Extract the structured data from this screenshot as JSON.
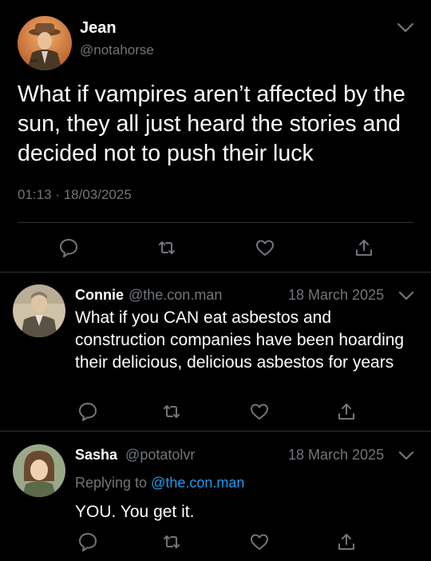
{
  "main_tweet": {
    "name": "Jean",
    "handle": "@notahorse",
    "text": "What if vampires aren’t affected by the sun, they all just heard the stories and decided not to push their luck",
    "time": "01:13",
    "separator": "·",
    "date": "18/03/2025"
  },
  "replies": [
    {
      "name": "Connie",
      "handle": "@the.con.man",
      "date": "18 March 2025",
      "text": "What if you CAN eat asbestos and construction companies have been hoarding their delicious, delicious asbestos for years"
    },
    {
      "name": "Sasha",
      "handle": "@potatolvr",
      "date": "18 March 2025",
      "replying_label": "Replying to",
      "replying_to": "@the.con.man",
      "text": "YOU. You get it."
    }
  ],
  "icons": [
    "reply-icon",
    "retweet-icon",
    "like-icon",
    "share-icon",
    "chevron-down-icon"
  ],
  "colors": {
    "background": "#000000",
    "text": "#ffffff",
    "muted": "#71767b",
    "link": "#1d9bf0",
    "divider": "#2f3336"
  }
}
